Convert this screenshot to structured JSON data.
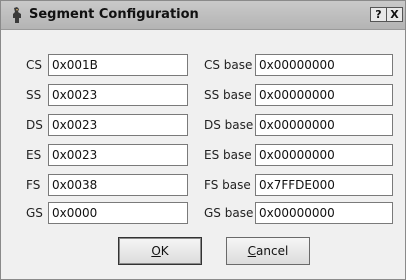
{
  "window": {
    "title": "Segment Configuration",
    "help_label": "?",
    "close_label": "X"
  },
  "segments": [
    {
      "name": "CS",
      "value": "0x001B",
      "base_label": "CS base",
      "base": "0x00000000"
    },
    {
      "name": "SS",
      "value": "0x0023",
      "base_label": "SS base",
      "base": "0x00000000"
    },
    {
      "name": "DS",
      "value": "0x0023",
      "base_label": "DS base",
      "base": "0x00000000"
    },
    {
      "name": "ES",
      "value": "0x0023",
      "base_label": "ES base",
      "base": "0x00000000"
    },
    {
      "name": "FS",
      "value": "0x0038",
      "base_label": "FS base",
      "base": "0x7FFDE000"
    },
    {
      "name": "GS",
      "value": "0x0000",
      "base_label": "GS base",
      "base": "0x00000000"
    }
  ],
  "buttons": {
    "ok_mnemonic": "O",
    "ok_rest": "K",
    "cancel_mnemonic": "C",
    "cancel_rest": "ancel"
  }
}
